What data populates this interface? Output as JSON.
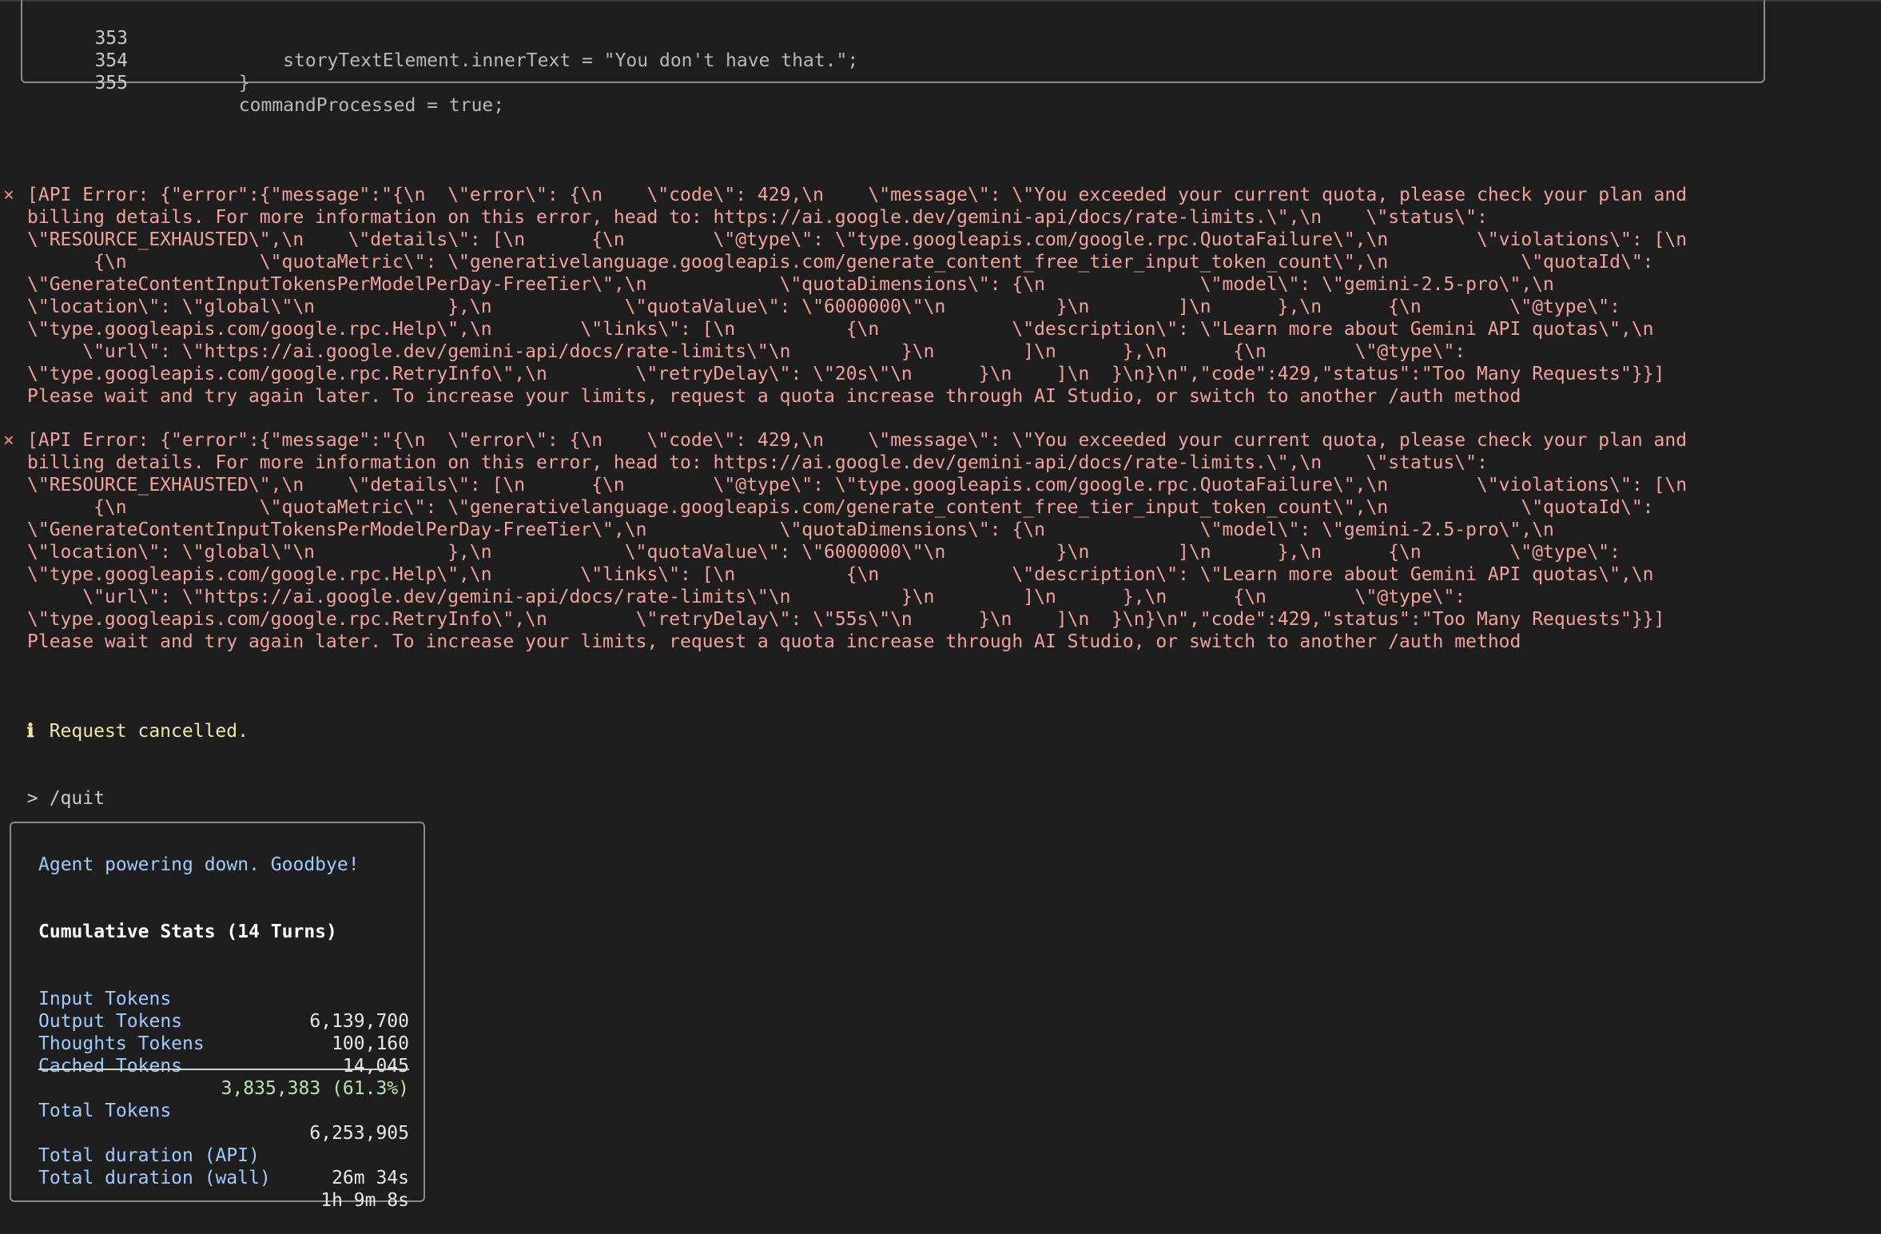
{
  "code_snippet": {
    "lines": [
      {
        "number": "353",
        "code": "            storyTextElement.innerText = \"You don't have that.\";"
      },
      {
        "number": "354",
        "code": "        }"
      },
      {
        "number": "355",
        "code": "        commandProcessed = true;"
      }
    ]
  },
  "error_icon": "x-mark-icon",
  "errors": [
    {
      "marker": "×",
      "lines": [
        "[API Error: {\"error\":{\"message\":\"{\\n  \\\"error\\\": {\\n    \\\"code\\\": 429,\\n    \\\"message\\\": \\\"You exceeded your current quota, please check your plan and",
        "billing details. For more information on this error, head to: https://ai.google.dev/gemini-api/docs/rate-limits.\\\",\\n    \\\"status\\\":",
        "\\\"RESOURCE_EXHAUSTED\\\",\\n    \\\"details\\\": [\\n      {\\n        \\\"@type\\\": \\\"type.googleapis.com/google.rpc.QuotaFailure\\\",\\n        \\\"violations\\\": [\\n",
        "      {\\n            \\\"quotaMetric\\\": \\\"generativelanguage.googleapis.com/generate_content_free_tier_input_token_count\\\",\\n            \\\"quotaId\\\":",
        "\\\"GenerateContentInputTokensPerModelPerDay-FreeTier\\\",\\n            \\\"quotaDimensions\\\": {\\n              \\\"model\\\": \\\"gemini-2.5-pro\\\",\\n",
        "\\\"location\\\": \\\"global\\\"\\n            },\\n            \\\"quotaValue\\\": \\\"6000000\\\"\\n          }\\n        ]\\n      },\\n      {\\n        \\\"@type\\\":",
        "\\\"type.googleapis.com/google.rpc.Help\\\",\\n        \\\"links\\\": [\\n          {\\n            \\\"description\\\": \\\"Learn more about Gemini API quotas\\\",\\n",
        "     \\\"url\\\": \\\"https://ai.google.dev/gemini-api/docs/rate-limits\\\"\\n          }\\n        ]\\n      },\\n      {\\n        \\\"@type\\\":",
        "\\\"type.googleapis.com/google.rpc.RetryInfo\\\",\\n        \\\"retryDelay\\\": \\\"20s\\\"\\n      }\\n    ]\\n  }\\n}\\n\",\"code\":429,\"status\":\"Too Many Requests\"}}]",
        "Please wait and try again later. To increase your limits, request a quota increase through AI Studio, or switch to another /auth method"
      ]
    },
    {
      "marker": "×",
      "lines": [
        "[API Error: {\"error\":{\"message\":\"{\\n  \\\"error\\\": {\\n    \\\"code\\\": 429,\\n    \\\"message\\\": \\\"You exceeded your current quota, please check your plan and",
        "billing details. For more information on this error, head to: https://ai.google.dev/gemini-api/docs/rate-limits.\\\",\\n    \\\"status\\\":",
        "\\\"RESOURCE_EXHAUSTED\\\",\\n    \\\"details\\\": [\\n      {\\n        \\\"@type\\\": \\\"type.googleapis.com/google.rpc.QuotaFailure\\\",\\n        \\\"violations\\\": [\\n",
        "      {\\n            \\\"quotaMetric\\\": \\\"generativelanguage.googleapis.com/generate_content_free_tier_input_token_count\\\",\\n            \\\"quotaId\\\":",
        "\\\"GenerateContentInputTokensPerModelPerDay-FreeTier\\\",\\n            \\\"quotaDimensions\\\": {\\n              \\\"model\\\": \\\"gemini-2.5-pro\\\",\\n",
        "\\\"location\\\": \\\"global\\\"\\n            },\\n            \\\"quotaValue\\\": \\\"6000000\\\"\\n          }\\n        ]\\n      },\\n      {\\n        \\\"@type\\\":",
        "\\\"type.googleapis.com/google.rpc.Help\\\",\\n        \\\"links\\\": [\\n          {\\n            \\\"description\\\": \\\"Learn more about Gemini API quotas\\\",\\n",
        "     \\\"url\\\": \\\"https://ai.google.dev/gemini-api/docs/rate-limits\\\"\\n          }\\n        ]\\n      },\\n      {\\n        \\\"@type\\\":",
        "\\\"type.googleapis.com/google.rpc.RetryInfo\\\",\\n        \\\"retryDelay\\\": \\\"55s\\\"\\n      }\\n    ]\\n  }\\n}\\n\",\"code\":429,\"status\":\"Too Many Requests\"}}]",
        "Please wait and try again later. To increase your limits, request a quota increase through AI Studio, or switch to another /auth method"
      ]
    }
  ],
  "info": {
    "icon": "info-icon",
    "icon_glyph": "ℹ",
    "text": "Request cancelled."
  },
  "prompt": {
    "symbol": ">",
    "command": "/quit"
  },
  "stats": {
    "goodbye": "Agent powering down. Goodbye!",
    "title": "Cumulative Stats (14 Turns)",
    "token_rows": [
      {
        "label": "Input Tokens",
        "value": "6,139,700"
      },
      {
        "label": "Output Tokens",
        "value": "100,160"
      },
      {
        "label": "Thoughts Tokens",
        "value": "14,045"
      },
      {
        "label": "Cached Tokens",
        "value": "3,835,383 (61.3%)"
      }
    ],
    "total": {
      "label": "Total Tokens",
      "value": "6,253,905"
    },
    "durations": [
      {
        "label": "Total duration (API)",
        "value": "26m 34s"
      },
      {
        "label": "Total duration (wall)",
        "value": "1h 9m 8s"
      }
    ]
  },
  "colors": {
    "background": "#1e1e1e",
    "error": "#f2a19a",
    "info": "#f1e6a6",
    "label": "#9ecbff",
    "cached": "#b9e6a6"
  }
}
